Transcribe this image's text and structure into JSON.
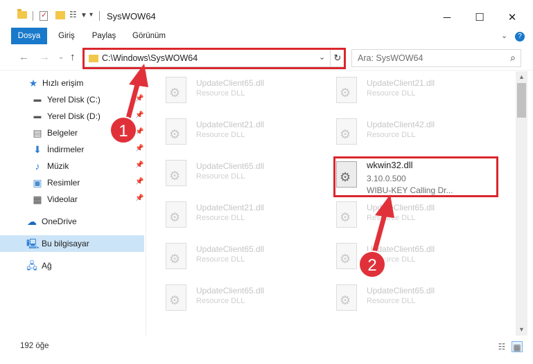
{
  "window": {
    "title": "SysWOW64",
    "controls": {
      "minimize": "─",
      "maximize": "☐",
      "close": "✕"
    }
  },
  "ribbon": {
    "tabs": [
      {
        "label": "Dosya",
        "active": true
      },
      {
        "label": "Giriş",
        "active": false
      },
      {
        "label": "Paylaş",
        "active": false
      },
      {
        "label": "Görünüm",
        "active": false
      }
    ],
    "expand_icon": "chevron-down-icon",
    "help_icon": "help-icon"
  },
  "address": {
    "path": "C:\\Windows\\SysWOW64",
    "refresh_icon": "refresh-icon"
  },
  "search": {
    "placeholder": "Ara: SysWOW64"
  },
  "sidebar": {
    "items": [
      {
        "label": "Hızlı erişim",
        "icon": "star-icon",
        "pinned": false
      },
      {
        "label": "Yerel Disk (C:)",
        "icon": "drive-icon",
        "pinned": true
      },
      {
        "label": "Yerel Disk (D:)",
        "icon": "drive-icon",
        "pinned": true
      },
      {
        "label": "Belgeler",
        "icon": "documents-icon",
        "pinned": true
      },
      {
        "label": "İndirmeler",
        "icon": "download-icon",
        "pinned": true
      },
      {
        "label": "Müzik",
        "icon": "music-icon",
        "pinned": true
      },
      {
        "label": "Resimler",
        "icon": "pictures-icon",
        "pinned": true
      },
      {
        "label": "Videolar",
        "icon": "videos-icon",
        "pinned": true
      },
      {
        "label": "OneDrive",
        "icon": "cloud-icon",
        "pinned": false
      },
      {
        "label": "Bu bilgisayar",
        "icon": "computer-icon",
        "pinned": false,
        "selected": true
      },
      {
        "label": "Ağ",
        "icon": "network-icon",
        "pinned": false
      }
    ]
  },
  "files": {
    "left": [
      {
        "name": "UpdateClient65.dll",
        "desc": "Resource DLL"
      },
      {
        "name": "UpdateClient21.dll",
        "desc": "Resource DLL"
      },
      {
        "name": "UpdateClient65.dll",
        "desc": "Resource DLL"
      },
      {
        "name": "UpdateClient21.dll",
        "desc": "Resource DLL"
      },
      {
        "name": "UpdateClient65.dll",
        "desc": "Resource DLL"
      },
      {
        "name": "UpdateClient65.dll",
        "desc": "Resource DLL"
      }
    ],
    "right": [
      {
        "name": "UpdateClient21.dll",
        "desc": "Resource DLL"
      },
      {
        "name": "UpdateClient42.dll",
        "desc": "Resource DLL"
      },
      {
        "name": "wkwin32.dll",
        "version": "3.10.0.500",
        "desc": "WIBU-KEY Calling Dr...",
        "focus": true
      },
      {
        "name": "UpdateClient65.dll",
        "desc": "Resource DLL"
      },
      {
        "name": "UpdateClient65.dll",
        "desc": "Resource DLL"
      },
      {
        "name": "UpdateClient65.dll",
        "desc": "Resource DLL"
      }
    ]
  },
  "callouts": [
    {
      "number": "1"
    },
    {
      "number": "2"
    }
  ],
  "status": {
    "count_text": "192 öğe"
  },
  "colors": {
    "accent": "#1979ca",
    "highlight": "#d9272e",
    "selected": "#cce4f7"
  }
}
